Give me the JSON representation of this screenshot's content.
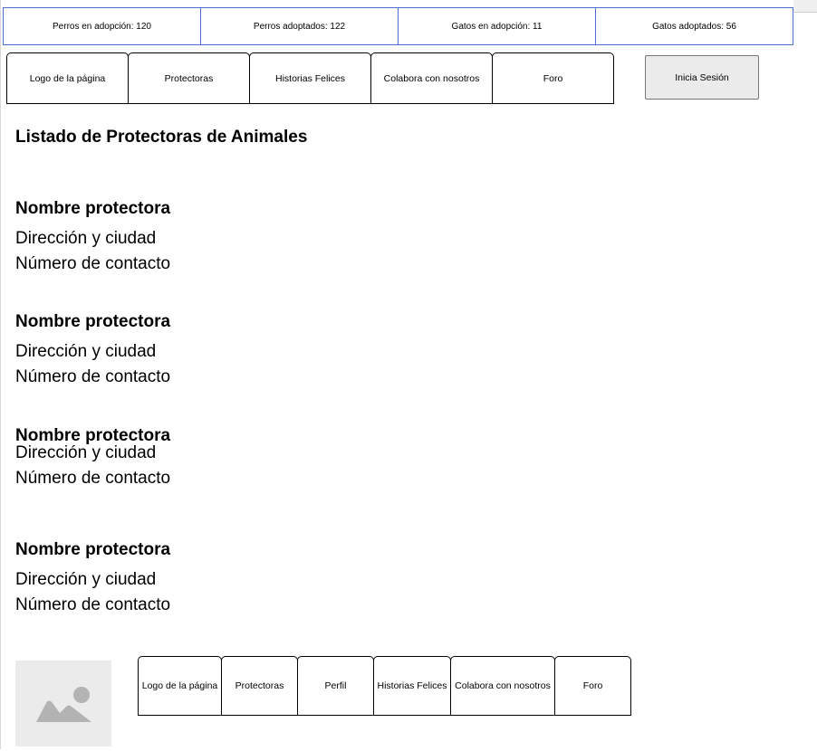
{
  "stats": [
    {
      "label": "Perros en adopción: 120"
    },
    {
      "label": "Perros adoptados: 122"
    },
    {
      "label": "Gatos en adopción: 11"
    },
    {
      "label": "Gatos adoptados: 56"
    }
  ],
  "nav": {
    "items": [
      {
        "label": "Logo de la página"
      },
      {
        "label": "Protectoras"
      },
      {
        "label": "Historias Felices"
      },
      {
        "label": "Colabora con nosotros"
      },
      {
        "label": "Foro"
      }
    ],
    "login_label": "Inicia Sesión"
  },
  "page": {
    "title": "Listado de Protectoras de Animales"
  },
  "shelters": [
    {
      "name": "Nombre protectora",
      "address": "Dirección y ciudad",
      "contact": "Número de contacto"
    },
    {
      "name": "Nombre protectora",
      "address": "Dirección y ciudad",
      "contact": "Número de contacto"
    },
    {
      "name": "Nombre protectora",
      "address": "Dirección y ciudad",
      "contact": "Número de contacto"
    },
    {
      "name": "Nombre protectora",
      "address": "Dirección y ciudad",
      "contact": "Número de contacto"
    }
  ],
  "footer": {
    "image_icon": "image-placeholder-icon",
    "items": [
      {
        "label": "Logo de la página"
      },
      {
        "label": "Protectoras"
      },
      {
        "label": "Perfil"
      },
      {
        "label": "Historias Felices"
      },
      {
        "label": "Colabora con nosotros"
      },
      {
        "label": "Foro"
      }
    ]
  },
  "colors": {
    "accent_border": "#4a6fd1",
    "button_bg": "#ebebeb",
    "placeholder_icon": "#b3b3b3"
  }
}
